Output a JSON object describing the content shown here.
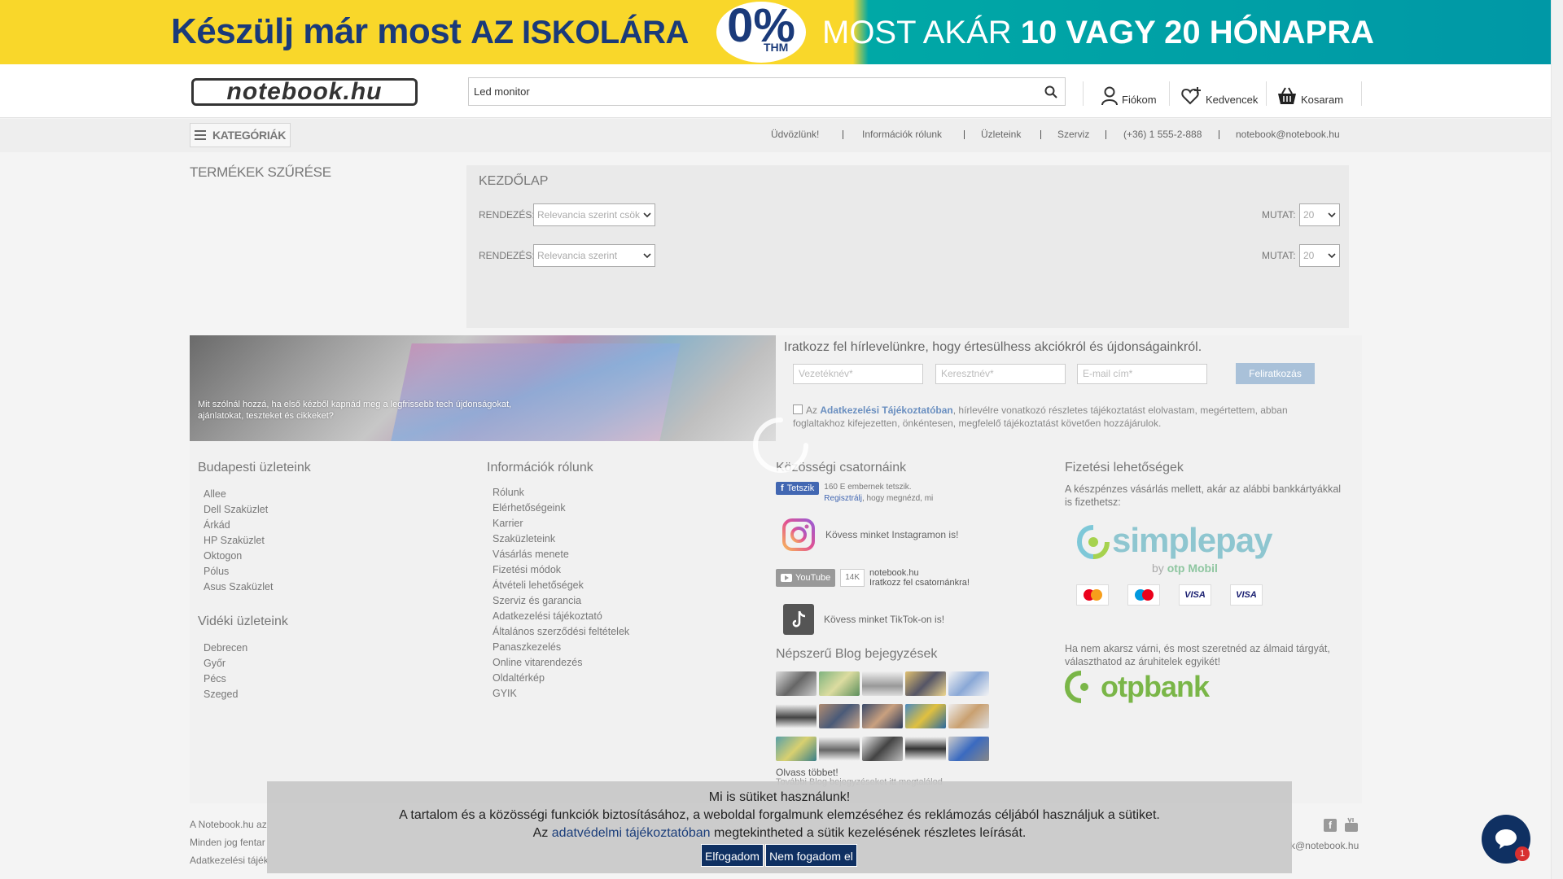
{
  "banner": {
    "left_text": "Készülj már most",
    "left_em": "AZ ISKOLÁRA",
    "zero": "0%",
    "thm": "THM",
    "right_text": "MOST AKÁR",
    "right_bold": "10 VAGY 20 HÓNAPRA"
  },
  "header": {
    "logo": "notebook.hu",
    "search_value": "Led monitor",
    "account": "Fiókom",
    "favorites": "Kedvencek",
    "cart": "Kosaram"
  },
  "nav": {
    "categories": "KATEGÓRIÁK",
    "links": [
      "Üdvözlünk!",
      "Információk rólunk",
      "Üzleteink",
      "Szerviz",
      "(+36) 1 555-2-888",
      "notebook@notebook.hu"
    ]
  },
  "main": {
    "filter_title": "TERMÉKEK SZŰRÉSE",
    "breadcrumb": "KEZDŐLAP",
    "sort_label": "RENDEZÉS:",
    "sort_value_1": "Relevancia szerint csök",
    "sort_value_2": "Relevancia szerint",
    "show_label": "MUTAT:",
    "show_value": "20"
  },
  "promo": {
    "caption": "Mit szólnál hozzá, ha első kézből kapnád meg a legfrissebb tech újdonságokat, ajánlatokat, teszteket és cikkeket?"
  },
  "newsletter": {
    "title": "Iratkozz fel hírlevelünkre, hogy értesülhess akciókról és újdonságainkról.",
    "lastname_placeholder": "Vezetéknév*",
    "firstname_placeholder": "Keresztnév*",
    "email_placeholder": "E-mail cím*",
    "subscribe": "Feliratkozás",
    "consent_pre": "Az",
    "consent_link": "Adatkezelési Tájékoztatóban",
    "consent_post": ", hírlevélre vonatkozó részletes tájékoztatást elolvastam, megértettem, abban foglaltakhoz kifejezetten, önkéntesen, megfelelő tájékoztatást követően hozzájárulok."
  },
  "footer": {
    "budapest_title": "Budapesti üzleteink",
    "budapest": [
      "Allee",
      "Dell Szaküzlet",
      "Árkád",
      "HP Szaküzlet",
      "Oktogon",
      "Pólus",
      "Asus Szaküzlet"
    ],
    "country_title": "Vidéki üzleteink",
    "country": [
      "Debrecen",
      "Győr",
      "Pécs",
      "Szeged"
    ],
    "info_title": "Információk rólunk",
    "info": [
      "Rólunk",
      "Elérhetőségeink",
      "Karrier",
      "Szaküzleteink",
      "Vásárlás menete",
      "Fizetési módok",
      "Átvételi lehetőségek",
      "Szerviz és garancia",
      "Adatkezelési tájékoztató",
      "Általános szerződési feltételek",
      "Panaszkezelés",
      "Online vitarendezés",
      "Oldaltérkép",
      "GYIK"
    ],
    "social_title": "Közösségi csatornáink",
    "fb_like": "Tetszik",
    "fb_text_1": "160 E embernek tetszik.",
    "fb_register": "Regisztrálj",
    "fb_text_2": ", hogy megnézd, mi",
    "instagram": "Kövess minket Instagramon is!",
    "youtube_btn": "YouTube",
    "youtube_count": "14K",
    "youtube_name": "notebook.hu",
    "youtube_sub": "Iratkozz fel csatornánkra!",
    "tiktok": "Kövess minket TikTok-on is!",
    "blog_title": "Népszerű Blog bejegyzések",
    "read_more": "Olvass többet!",
    "blog_more": "További Blog bejegyzéseket itt megtalálod",
    "payment_title": "Fizetési lehetőségek",
    "payment_text": "A készpénzes vásárlás mellett, akár az alábbi bankkártyákkal is fizethetsz:",
    "simplepay": "simplepay",
    "simplepay_by": "by",
    "otp_mobil": "otp Mobil",
    "card_visa": "VISA",
    "credit_text": "Ha nem akarsz várni, és most szeretnéd az álmaid tárgyát, választhatod az áruhitelek egyikét!",
    "otpbank": "otpbank"
  },
  "bottom": {
    "line1": "A Notebook.hu az",
    "line2": "Minden jog fentar",
    "line3": "Adatkezelési tájék",
    "email": "k@notebook.hu"
  },
  "cookie": {
    "title": "Mi is sütiket használunk!",
    "line2": "A tartalom és a közösségi funkciók biztosításához, a weboldal forgalmunk elemzéséhez és reklámozás céljából használjuk a sütiket.",
    "line3_pre": "Az",
    "line3_link": "adatvédelmi tájékoztatóban",
    "line3_post": "megtekintheted a sütik kezelésének részletes leírását.",
    "accept": "Elfogadom",
    "decline": "Nem fogadom el"
  },
  "chat": {
    "badge": "1"
  },
  "colors": {
    "brand_blue": "#0f3062",
    "banner_yellow": "#f9d72a",
    "banner_teal": "#00a8a6"
  }
}
